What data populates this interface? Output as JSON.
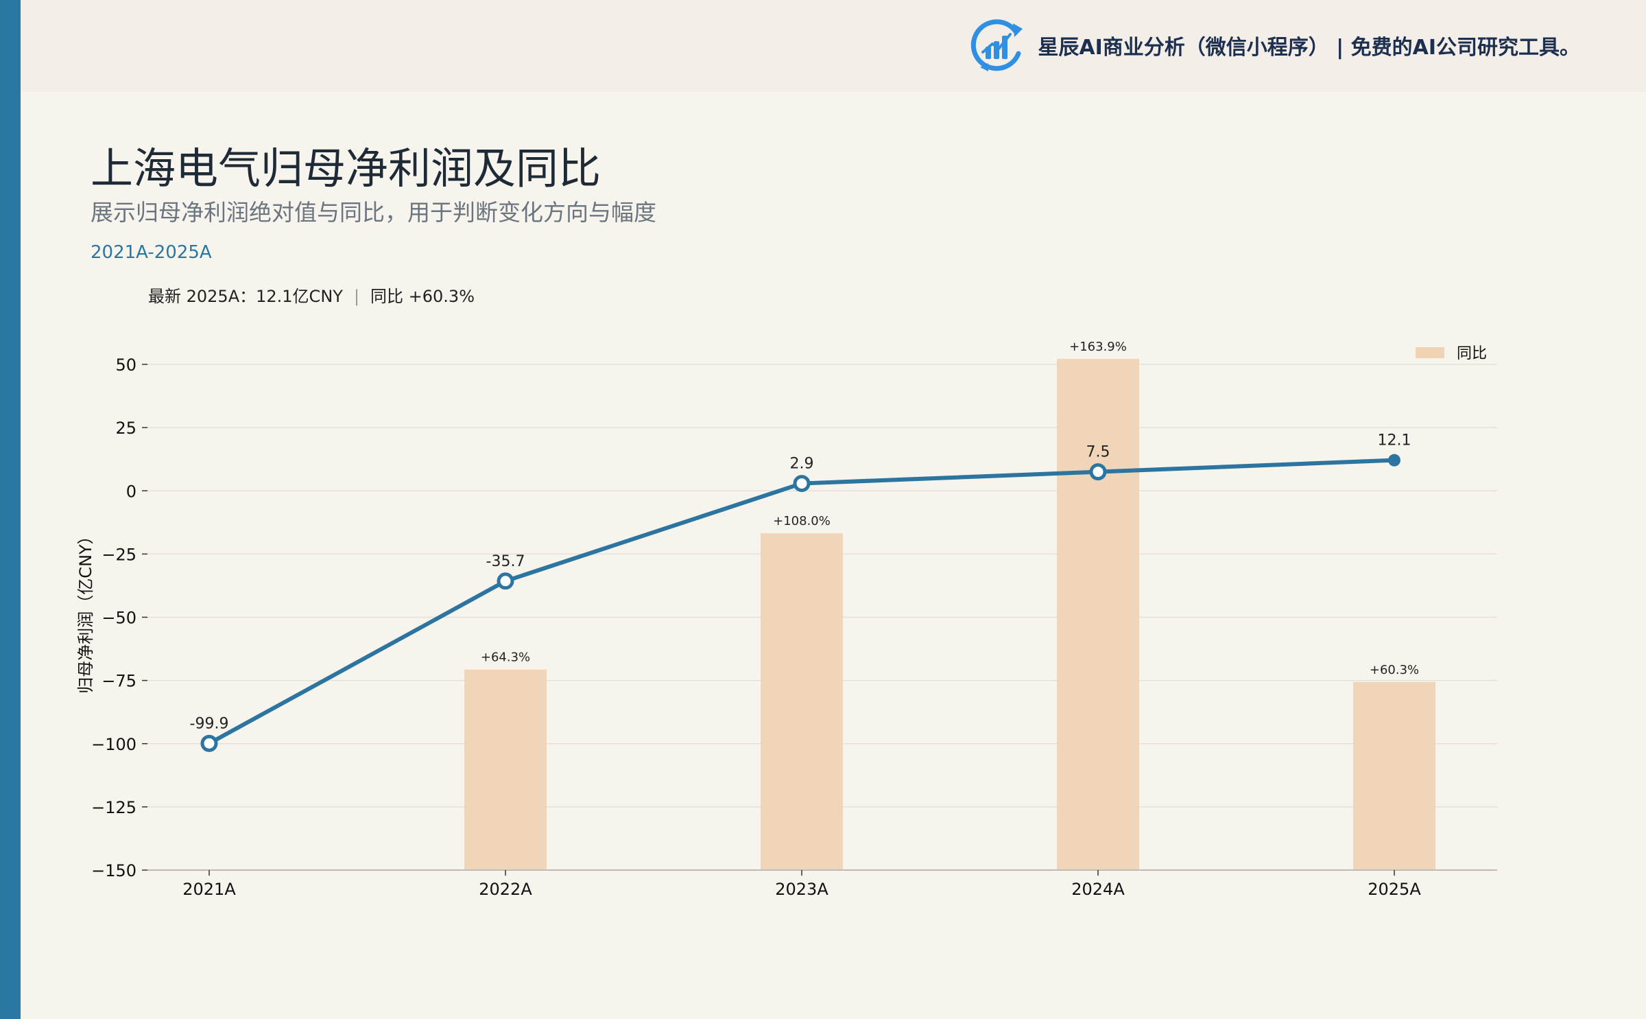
{
  "header": {
    "brand_text": "星辰AI商业分析（微信小程序）  |  免费的AI公司研究工具。",
    "logo_icon": "bar-chart-refresh-icon"
  },
  "title": "上海电气归母净利润及同比",
  "subtitle": "展示归母净利润绝对值与同比，用于判断变化方向与幅度",
  "period": "2021A-2025A",
  "latest": {
    "value_text": "最新 2025A：12.1亿CNY",
    "yoy_text": "同比 +60.3%"
  },
  "colors": {
    "line": "#2c75a0",
    "bar": "#f0d3b5",
    "accent": "#2878a3"
  },
  "chart_data": {
    "type": "bar",
    "categories": [
      "2021A",
      "2022A",
      "2023A",
      "2024A",
      "2025A"
    ],
    "ylabel": "归母净利润（亿CNY）",
    "ylim": [
      -150,
      60
    ],
    "yticks": [
      50,
      25,
      0,
      -25,
      -50,
      -75,
      -100,
      -125,
      -150
    ],
    "grid": true,
    "legend_position": "top-right",
    "series": [
      {
        "type": "line",
        "values": [
          -99.9,
          -35.7,
          2.9,
          7.5,
          12.1
        ],
        "labels": [
          "-99.9",
          "-35.7",
          "2.9",
          "7.5",
          "12.1"
        ]
      },
      {
        "type": "bar",
        "name": "同比",
        "values": [
          null,
          64.3,
          108.0,
          163.9,
          60.3
        ],
        "labels": [
          "",
          "+64.3%",
          "+108.0%",
          "+163.9%",
          "+60.3%"
        ]
      }
    ]
  }
}
